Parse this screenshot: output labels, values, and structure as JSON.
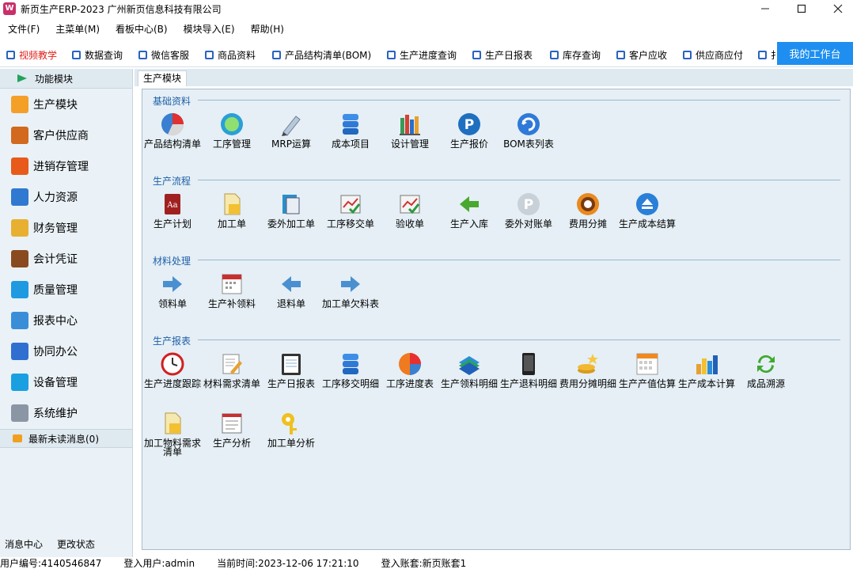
{
  "window": {
    "title": "新页生产ERP-2023 广州新页信息科技有限公司",
    "app_icon_letter": "W",
    "controls": [
      "minimize",
      "maximize",
      "close"
    ]
  },
  "menu": [
    "文件(F)",
    "主菜单(M)",
    "看板中心(B)",
    "模块导入(E)",
    "帮助(H)"
  ],
  "quickbar": {
    "items": [
      {
        "label": "视频教学",
        "highlight": true
      },
      {
        "label": "数据查询"
      },
      {
        "label": "微信客服"
      },
      {
        "label": "商品资料"
      },
      {
        "label": "产品结构清单(BOM)"
      },
      {
        "label": "生产进度查询"
      },
      {
        "label": "生产日报表"
      },
      {
        "label": "库存查询"
      },
      {
        "label": "客户应收"
      },
      {
        "label": "供应商应付"
      },
      {
        "label": "扌"
      }
    ],
    "workbench_label": "我的工作台"
  },
  "sidebar": {
    "header": "功能模块",
    "items": [
      {
        "label": "生产模块",
        "icon": "folder-icon",
        "color": "#f4a028"
      },
      {
        "label": "客户供应商",
        "icon": "users-icon",
        "color": "#d2691e"
      },
      {
        "label": "进销存管理",
        "icon": "bar-chart-icon",
        "color": "#e85a1a"
      },
      {
        "label": "人力资源",
        "icon": "person-icon",
        "color": "#2f79d0"
      },
      {
        "label": "财务管理",
        "icon": "coins-icon",
        "color": "#e8b030"
      },
      {
        "label": "会计凭证",
        "icon": "notebook-icon",
        "color": "#8a4a20"
      },
      {
        "label": "质量管理",
        "icon": "tiles-icon",
        "color": "#1f9ae0"
      },
      {
        "label": "报表中心",
        "icon": "report-icon",
        "color": "#3a8ed8"
      },
      {
        "label": "协同办公",
        "icon": "calendar-icon",
        "color": "#2f6fd0"
      },
      {
        "label": "设备管理",
        "icon": "device-icon",
        "color": "#1aa0e0"
      },
      {
        "label": "系统维护",
        "icon": "lock-icon",
        "color": "#8a96a4"
      }
    ],
    "messages": "最新未读消息(0)",
    "bottom_links": [
      "消息中心",
      "更改状态"
    ]
  },
  "tab": "生产模块",
  "sections": [
    {
      "title": "基础资料",
      "tiles": [
        {
          "label": "产品结构清单",
          "icon": "pie-ball-icon"
        },
        {
          "label": "工序管理",
          "icon": "green-ball-icon"
        },
        {
          "label": "MRP运算",
          "icon": "pen-icon"
        },
        {
          "label": "成本项目",
          "icon": "database-icon"
        },
        {
          "label": "设计管理",
          "icon": "books-icon"
        },
        {
          "label": "生产报价",
          "icon": "p-badge-icon"
        },
        {
          "label": "BOM表列表",
          "icon": "refresh-ball-icon"
        }
      ]
    },
    {
      "title": "生产流程",
      "tiles": [
        {
          "label": "生产计划",
          "icon": "dictionary-icon"
        },
        {
          "label": "加工单",
          "icon": "file-folder-icon"
        },
        {
          "label": "委外加工单",
          "icon": "book-stack-icon"
        },
        {
          "label": "工序移交单",
          "icon": "chart-check-icon"
        },
        {
          "label": "验收单",
          "icon": "chart-check-icon"
        },
        {
          "label": "生产入库",
          "icon": "arrow-left-green-icon"
        },
        {
          "label": "委外对账单",
          "icon": "p-grey-badge-icon"
        },
        {
          "label": "费用分摊",
          "icon": "donut-icon"
        },
        {
          "label": "生产成本结算",
          "icon": "eject-icon"
        }
      ]
    },
    {
      "title": "材料处理",
      "tiles": [
        {
          "label": "领料单",
          "icon": "arrow-right-icon"
        },
        {
          "label": "生产补领料",
          "icon": "calendar-page-icon"
        },
        {
          "label": "退料单",
          "icon": "arrow-left-icon"
        },
        {
          "label": "加工单欠料表",
          "icon": "arrow-right-icon"
        }
      ]
    },
    {
      "title": "生产报表",
      "tiles": [
        {
          "label": "生产进度跟踪",
          "icon": "clock-icon"
        },
        {
          "label": "材料需求清单",
          "icon": "edit-doc-icon"
        },
        {
          "label": "生产日报表",
          "icon": "clipboard-icon"
        },
        {
          "label": "工序移交明细",
          "icon": "database-icon"
        },
        {
          "label": "工序进度表",
          "icon": "pie-icon"
        },
        {
          "label": "生产领料明细",
          "icon": "books-blue-icon"
        },
        {
          "label": "生产退料明细",
          "icon": "phone-doc-icon"
        },
        {
          "label": "费用分摊明细",
          "icon": "coins-star-icon"
        },
        {
          "label": "生产产值估算",
          "icon": "calendar-grid-icon"
        },
        {
          "label": "生产成本计算",
          "icon": "bar-chart-icon"
        },
        {
          "label": "成品溯源",
          "icon": "recycle-icon"
        },
        {
          "label": "加工物料需求清单",
          "icon": "file-folder-icon"
        },
        {
          "label": "生产分析",
          "icon": "form-icon"
        },
        {
          "label": "加工单分析",
          "icon": "key-icon"
        }
      ]
    }
  ],
  "status": {
    "user_id": "用户编号:4140546847",
    "login_user": "登入用户:admin",
    "current_time": "当前时间:2023-12-06 17:21:10",
    "account": "登入账套:新页账套1"
  }
}
